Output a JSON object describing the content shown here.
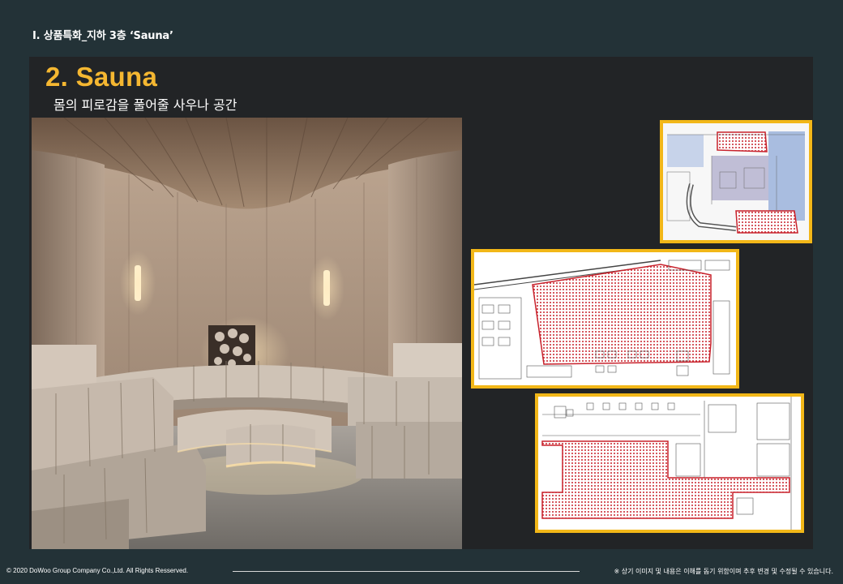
{
  "header": {
    "title": "Ⅰ. 상품특화_지하 3층 ‘Sauna’"
  },
  "section": {
    "title": "2.  Sauna",
    "subtitle": "몸의 피로감을 풀어줄 사우나 공간"
  },
  "photo": {
    "icon": "sauna-interior-photo"
  },
  "plans": [
    {
      "icon": "floor-plan-overview"
    },
    {
      "icon": "floor-plan-sauna-upper"
    },
    {
      "icon": "floor-plan-sauna-lower"
    }
  ],
  "footer": {
    "copyright": "© 2020 DoWoo Group Company Co.,Ltd. All Rights Resserved.",
    "note": "※ 상기 이미지 및 내용은 이해를 돕기 위함이며 추후 변경 및 수정될 수 있습니다."
  },
  "colors": {
    "accent": "#f5b731",
    "background": "#233237",
    "panel": "#222426",
    "highlight": "#cc1f1f"
  }
}
